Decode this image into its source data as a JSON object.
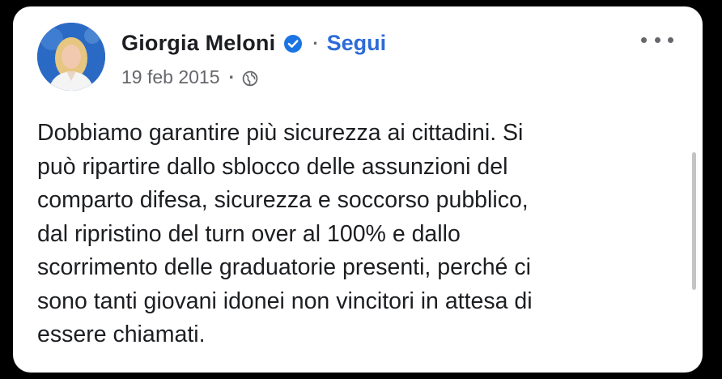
{
  "post": {
    "author_name": "Giorgia Meloni",
    "follow_label": "Segui",
    "separator": "·",
    "date": "19 feb 2015",
    "text": "Dobbiamo garantire più sicurezza ai cittadini. Si\npuò ripartire dallo sblocco delle assunzioni del\ncomparto difesa, sicurezza e soccorso pubblico,\ndal ripristino del turn over al 100% e dallo\nscorrimento delle graduatorie presenti, perché ci\nsono tanti giovani idonei non vincitori in attesa di\nessere chiamati."
  },
  "icons": {
    "verified": "verified-badge-icon",
    "audience": "globe-icon",
    "menu": "more-options-icon"
  },
  "colors": {
    "background": "#000000",
    "card": "#ffffff",
    "link_blue": "#2d6bd8",
    "verified_blue": "#1b74e4",
    "secondary_text": "#65676b",
    "primary_text": "#1c1e21"
  }
}
